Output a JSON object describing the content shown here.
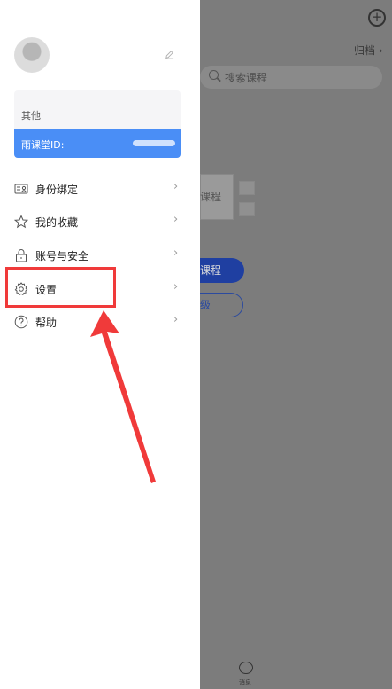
{
  "background": {
    "archive_label": "归档",
    "search_placeholder": "搜索课程",
    "card_text": "课程",
    "primary_button": "课程",
    "secondary_button": "级",
    "bottom_tab_label": "消息"
  },
  "drawer": {
    "section_label": "其他",
    "id_label": "雨课堂ID:",
    "menu": [
      {
        "label": "身份绑定",
        "icon": "id-card-icon"
      },
      {
        "label": "我的收藏",
        "icon": "star-icon"
      },
      {
        "label": "账号与安全",
        "icon": "lock-icon"
      },
      {
        "label": "设置",
        "icon": "gear-icon"
      },
      {
        "label": "帮助",
        "icon": "help-icon"
      }
    ],
    "chevron": "›"
  },
  "colors": {
    "accent_blue": "#4a8ef6",
    "highlight_red": "#f03a3a",
    "overlay_gray": "#7c7c7c"
  }
}
